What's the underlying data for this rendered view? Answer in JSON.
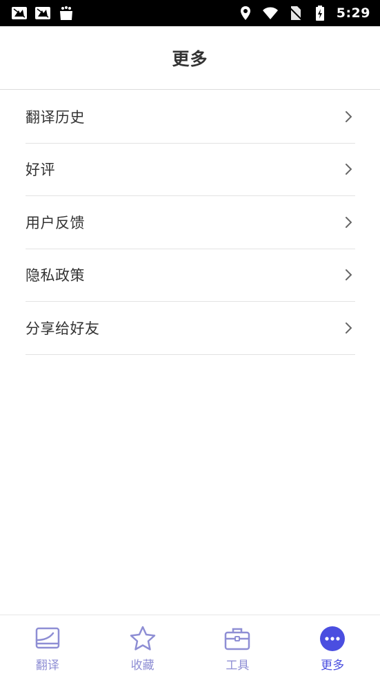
{
  "status_bar": {
    "time": "5:29",
    "left_icons": [
      "news-icon",
      "news-icon",
      "store-bag-icon"
    ],
    "right_icons": [
      "location-icon",
      "wifi-icon",
      "no-sim-icon",
      "battery-charging-icon"
    ]
  },
  "header": {
    "title": "更多"
  },
  "menu": {
    "items": [
      {
        "label": "翻译历史",
        "icon": "chevron-right-icon"
      },
      {
        "label": "好评",
        "icon": "chevron-right-icon"
      },
      {
        "label": "用户反馈",
        "icon": "chevron-right-icon"
      },
      {
        "label": "隐私政策",
        "icon": "chevron-right-icon"
      },
      {
        "label": "分享给好友",
        "icon": "chevron-right-icon"
      }
    ]
  },
  "bottom_nav": {
    "items": [
      {
        "label": "翻译",
        "icon": "translate-icon",
        "active": false
      },
      {
        "label": "收藏",
        "icon": "star-icon",
        "active": false
      },
      {
        "label": "工具",
        "icon": "toolbox-icon",
        "active": false
      },
      {
        "label": "更多",
        "icon": "more-dots-icon",
        "active": true
      }
    ]
  },
  "colors": {
    "accent": "#4a4ee0",
    "inactive_nav": "#8e8ed4",
    "text": "#333333",
    "divider": "#e2e2e2",
    "status_bar": "#000000"
  }
}
